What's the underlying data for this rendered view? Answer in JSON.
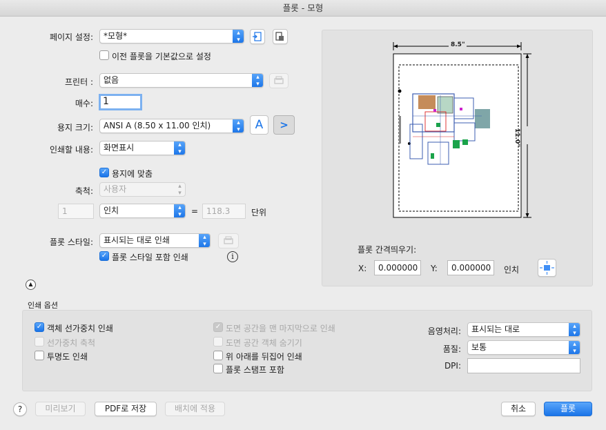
{
  "window": {
    "title": "플롯 - 모형"
  },
  "page_setup": {
    "label": "페이지 설정:",
    "value": "*모형*",
    "checkbox_label": "이전 플롯을 기본값으로 설정"
  },
  "printer": {
    "label": "프린터 :",
    "value": "없음"
  },
  "copies": {
    "label": "매수:",
    "value": "1"
  },
  "paper_size": {
    "label": "용지 크기:",
    "value": "ANSI A (8.50 x 11.00 인치)"
  },
  "plot_area": {
    "label": "인쇄할 내용:",
    "value": "화면표시"
  },
  "fit_to_paper": {
    "label": "용지에 맞춤",
    "checked": true
  },
  "scale": {
    "label": "축척:",
    "value": "사용자",
    "left_value": "1",
    "unit": "인치",
    "equals": "=",
    "right_value": "118.3",
    "units_label": "단위"
  },
  "plot_style": {
    "label": "플롯 스타일:",
    "value": "표시되는 대로 인쇄",
    "checkbox_label": "플롯 스타일 포함 인쇄",
    "info_glyph": "i"
  },
  "preview": {
    "width_label": "8.5\"",
    "height_label": "11.0\""
  },
  "offset": {
    "label": "플롯 간격띄우기:",
    "x_label": "X:",
    "x_value": "0.000000",
    "y_label": "Y:",
    "y_value": "0.000000",
    "unit": "인치"
  },
  "print_options": {
    "title": "인쇄 옵션",
    "col1": [
      {
        "label": "객체 선가중치 인쇄",
        "checked": true,
        "enabled": true
      },
      {
        "label": "선가중치 축척",
        "checked": false,
        "enabled": false
      },
      {
        "label": "투명도 인쇄",
        "checked": false,
        "enabled": true
      }
    ],
    "col2": [
      {
        "label": "도면 공간을 맨 마지막으로 인쇄",
        "checked": true,
        "enabled": false
      },
      {
        "label": "도면 공간 객체 숨기기",
        "checked": false,
        "enabled": false
      },
      {
        "label": "위 아래를 뒤집어 인쇄",
        "checked": false,
        "enabled": true
      },
      {
        "label": "플롯 스탬프 포함",
        "checked": false,
        "enabled": true
      }
    ],
    "shade": {
      "label": "음영처리:",
      "value": "표시되는 대로"
    },
    "quality": {
      "label": "품질:",
      "value": "보통"
    },
    "dpi": {
      "label": "DPI:",
      "value": ""
    }
  },
  "footer": {
    "help": "?",
    "preview": "미리보기",
    "save_pdf": "PDF로 저장",
    "apply_layout": "배치에 적용",
    "cancel": "취소",
    "plot": "플롯"
  },
  "colors": {
    "accent": "#1a74e8",
    "panel": "#e2e2e2",
    "background": "#ececec"
  }
}
